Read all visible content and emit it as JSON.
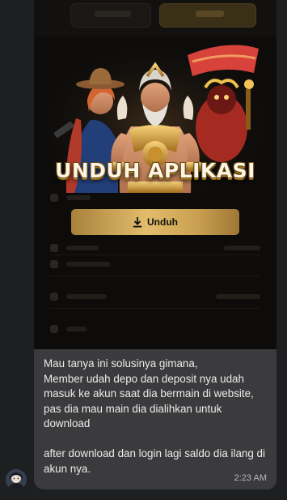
{
  "banner": {
    "title": "UNDUH APLIKASI",
    "button_label": "Unduh",
    "icon": "download-icon"
  },
  "message": {
    "paragraph_1": "Mau tanya ini solusinya gimana,\nMember udah depo dan deposit nya udah masuk ke akun saat dia bermain di website, pas dia mau main dia dialihkan untuk download",
    "paragraph_2": "after download dan login lagi saldo dia ilang di akun nya.",
    "time": "2:23 AM"
  },
  "colors": {
    "bubble": "#3b3b3d",
    "background": "#1e1f21",
    "gold": "#e2bd6c"
  }
}
